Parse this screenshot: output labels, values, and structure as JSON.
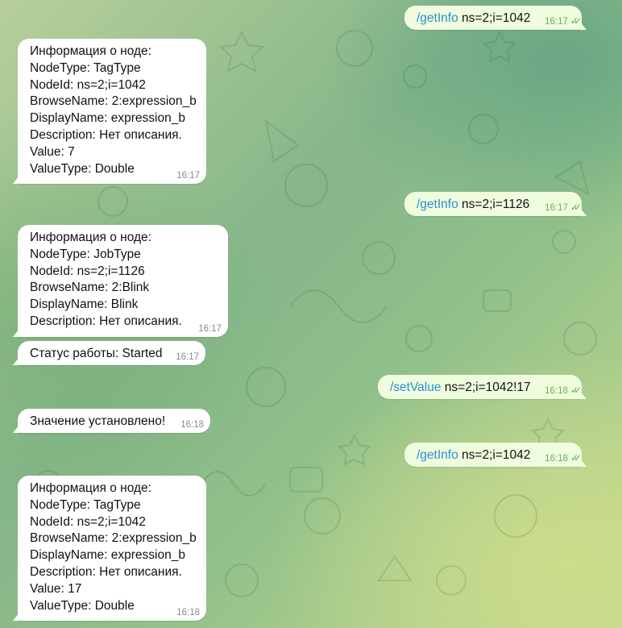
{
  "messages": [
    {
      "dir": "out",
      "command": "/getInfo",
      "args": "ns=2;i=1042",
      "time": "16:17",
      "read": true
    },
    {
      "dir": "in",
      "lines": [
        "Информация о ноде:",
        "NodeType:  TagType",
        "NodeId: ns=2;i=1042",
        "BrowseName: 2:expression_b",
        "DisplayName: expression_b",
        "Description: Нет описания.",
        "Value: 7",
        "ValueType: Double"
      ],
      "time": "16:17"
    },
    {
      "dir": "out",
      "command": "/getInfo",
      "args": "ns=2;i=1126",
      "time": "16:17",
      "read": true
    },
    {
      "dir": "in",
      "lines": [
        "Информация о ноде:",
        "NodeType:  JobType",
        "NodeId: ns=2;i=1126",
        "BrowseName: 2:Blink",
        "DisplayName: Blink",
        "Description: Нет описания."
      ],
      "time": "16:17"
    },
    {
      "dir": "in",
      "lines": [
        "Статус работы: Started"
      ],
      "time": "16:17"
    },
    {
      "dir": "out",
      "command": "/setValue",
      "args": "ns=2;i=1042!17",
      "time": "16:18",
      "read": true
    },
    {
      "dir": "in",
      "lines": [
        "Значение установлено!"
      ],
      "time": "16:18"
    },
    {
      "dir": "out",
      "command": "/getInfo",
      "args": "ns=2;i=1042",
      "time": "16:18",
      "read": true
    },
    {
      "dir": "in",
      "lines": [
        "Информация о ноде:",
        "NodeType:  TagType",
        "NodeId: ns=2;i=1042",
        "BrowseName: 2:expression_b",
        "DisplayName: expression_b",
        "Description: Нет описания.",
        "Value: 17",
        "ValueType: Double"
      ],
      "time": "16:18"
    }
  ],
  "colors": {
    "command": "#2a8fd6",
    "incoming_bg": "#ffffff",
    "outgoing_bg": "#effdde",
    "read_checks": "#4fae4e"
  },
  "icons": {
    "read_receipt": "double-check-icon"
  }
}
